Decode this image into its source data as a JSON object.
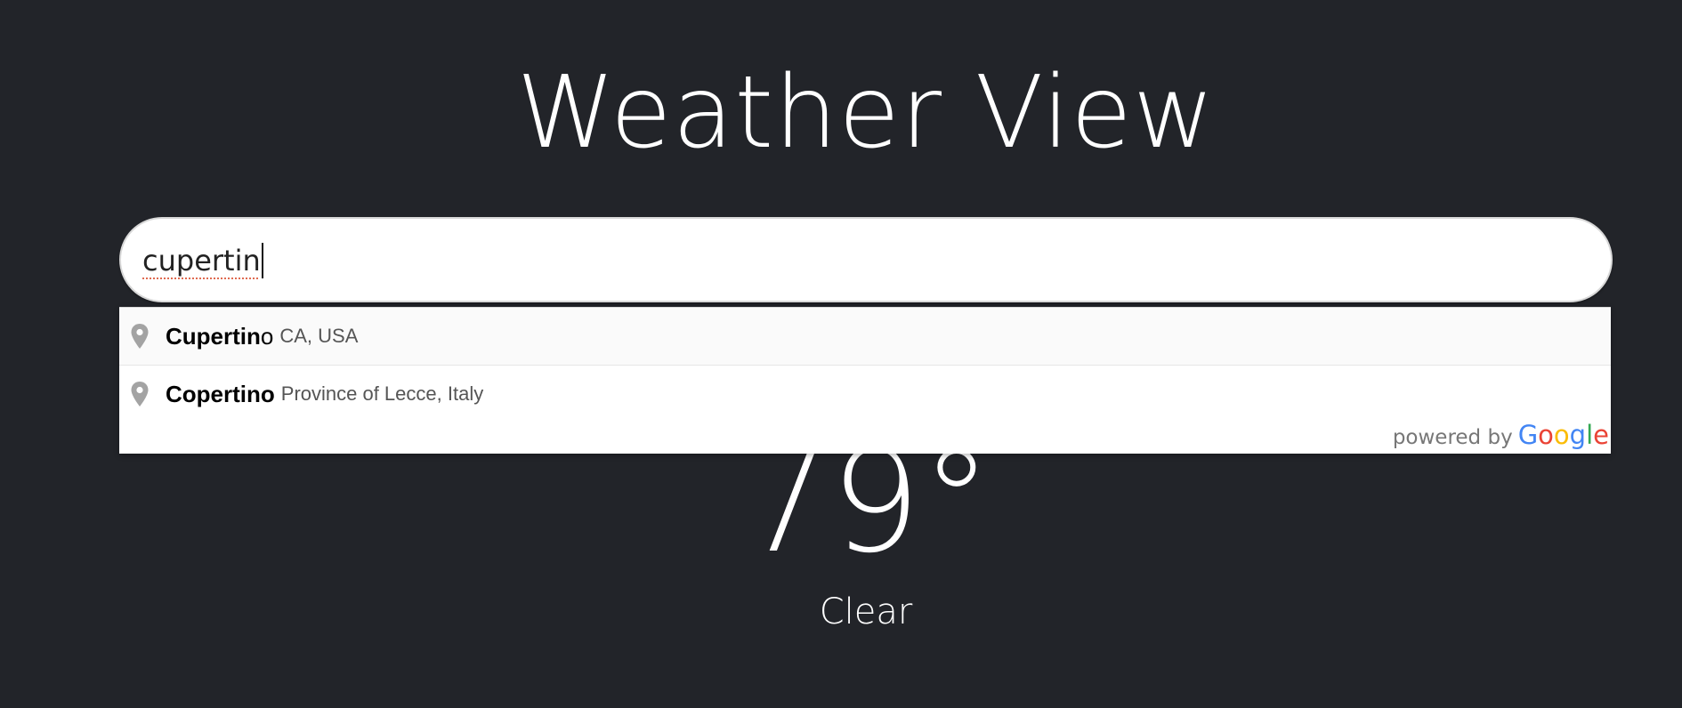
{
  "app": {
    "title": "Weather View"
  },
  "search": {
    "value": "cupertin"
  },
  "suggestions": [
    {
      "match": "Cupertin",
      "rest": "o",
      "secondary": "CA, USA"
    },
    {
      "match": "Copertino",
      "rest": "",
      "secondary": "Province of Lecce, Italy"
    }
  ],
  "attribution": {
    "label": "powered by",
    "brand": "Google",
    "brand_colors": [
      "#4285F4",
      "#EA4335",
      "#FBBC05",
      "#4285F4",
      "#34A853",
      "#EA4335"
    ]
  },
  "weather": {
    "temperature": "79°",
    "condition": "Clear"
  },
  "icons": {
    "suggestion_pin": "map-pin-icon"
  },
  "colors": {
    "background": "#222429",
    "text": "#ffffff"
  }
}
